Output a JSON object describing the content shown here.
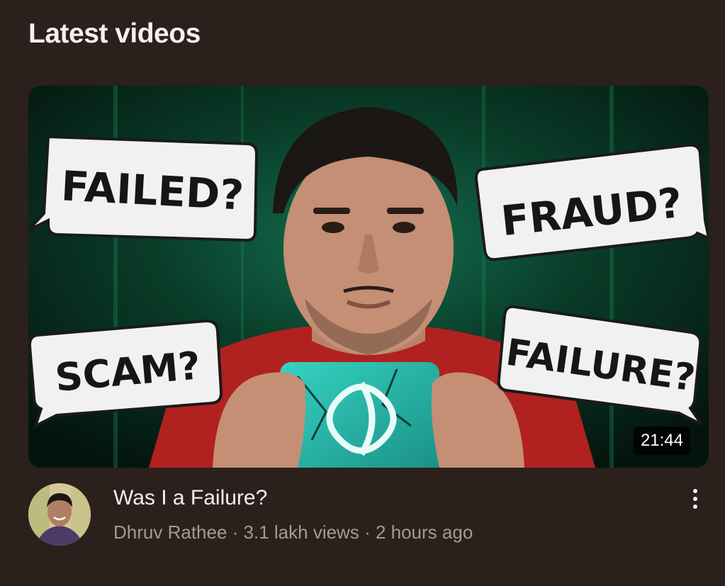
{
  "section": {
    "title": "Latest videos"
  },
  "video": {
    "title": "Was I a Failure?",
    "channel": "Dhruv Rathee",
    "views": "3.1 lakh views",
    "age": "2 hours ago",
    "separator": " · ",
    "duration": "21:44",
    "thumbnail": {
      "bubbles": [
        "FAILED?",
        "FRAUD?",
        "SCAM?",
        "FAILURE?"
      ],
      "shirt_color": "#b0211f",
      "phone_color": "#2bbfae",
      "background_color": "#0b3b28"
    }
  },
  "icons": {
    "more": "more-vert-icon"
  }
}
